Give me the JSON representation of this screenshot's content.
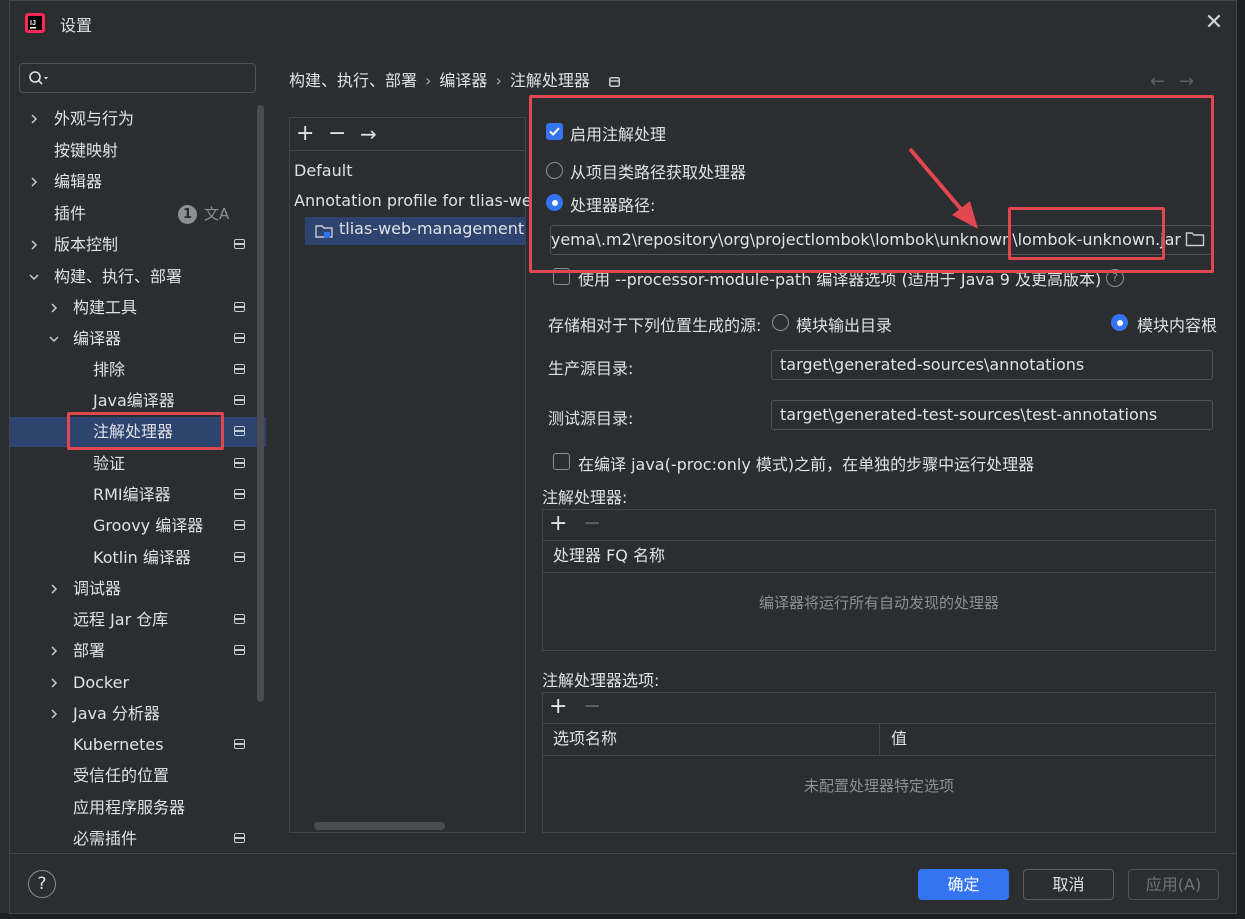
{
  "window": {
    "title": "设置"
  },
  "sidebar": {
    "items": [
      {
        "label": "外观与行为"
      },
      {
        "label": "按键映射"
      },
      {
        "label": "编辑器"
      },
      {
        "label": "插件",
        "badge": "1"
      },
      {
        "label": "版本控制"
      },
      {
        "label": "构建、执行、部署"
      },
      {
        "label": "构建工具"
      },
      {
        "label": "编译器"
      },
      {
        "label": "排除"
      },
      {
        "label": "Java编译器"
      },
      {
        "label": "注解处理器"
      },
      {
        "label": "验证"
      },
      {
        "label": "RMI编译器"
      },
      {
        "label": "Groovy 编译器"
      },
      {
        "label": "Kotlin 编译器"
      },
      {
        "label": "调试器"
      },
      {
        "label": "远程 Jar 仓库"
      },
      {
        "label": "部署"
      },
      {
        "label": "Docker"
      },
      {
        "label": "Java 分析器"
      },
      {
        "label": "Kubernetes"
      },
      {
        "label": "受信任的位置"
      },
      {
        "label": "应用程序服务器"
      },
      {
        "label": "必需插件"
      }
    ]
  },
  "breadcrumb": {
    "part1": "构建、执行、部署",
    "part2": "编译器",
    "part3": "注解处理器"
  },
  "profiles": {
    "default_label": "Default",
    "profile_label": "Annotation profile for tlias-we",
    "module_label": "tlias-web-management"
  },
  "settings": {
    "enable_label": "启用注解处理",
    "from_classpath_label": "从项目类路径获取处理器",
    "processor_path_label": "处理器路径:",
    "processor_path_value": "yema\\.m2\\repository\\org\\projectlombok\\lombok\\unknown\\lombok-unknown.jar",
    "module_path_label": "使用 --processor-module-path 编译器选项 (适用于 Java 9 及更高版本)",
    "store_label": "存储相对于下列位置生成的源:",
    "module_output_label": "模块输出目录",
    "content_root_label": "模块内容根",
    "prod_dir_label": "生产源目录:",
    "prod_dir_value": "target\\generated-sources\\annotations",
    "test_dir_label": "测试源目录:",
    "test_dir_value": "target\\generated-test-sources\\test-annotations",
    "run_before_label": "在编译 java(-proc:only 模式)之前，在单独的步骤中运行处理器"
  },
  "processors_table": {
    "title": "注解处理器:",
    "column": "处理器 FQ 名称",
    "empty": "编译器将运行所有自动发现的处理器"
  },
  "options_table": {
    "title": "注解处理器选项:",
    "col_name": "选项名称",
    "col_value": "值",
    "empty": "未配置处理器特定选项"
  },
  "footer": {
    "help": "?",
    "ok": "确定",
    "cancel": "取消",
    "apply": "应用(A)"
  }
}
